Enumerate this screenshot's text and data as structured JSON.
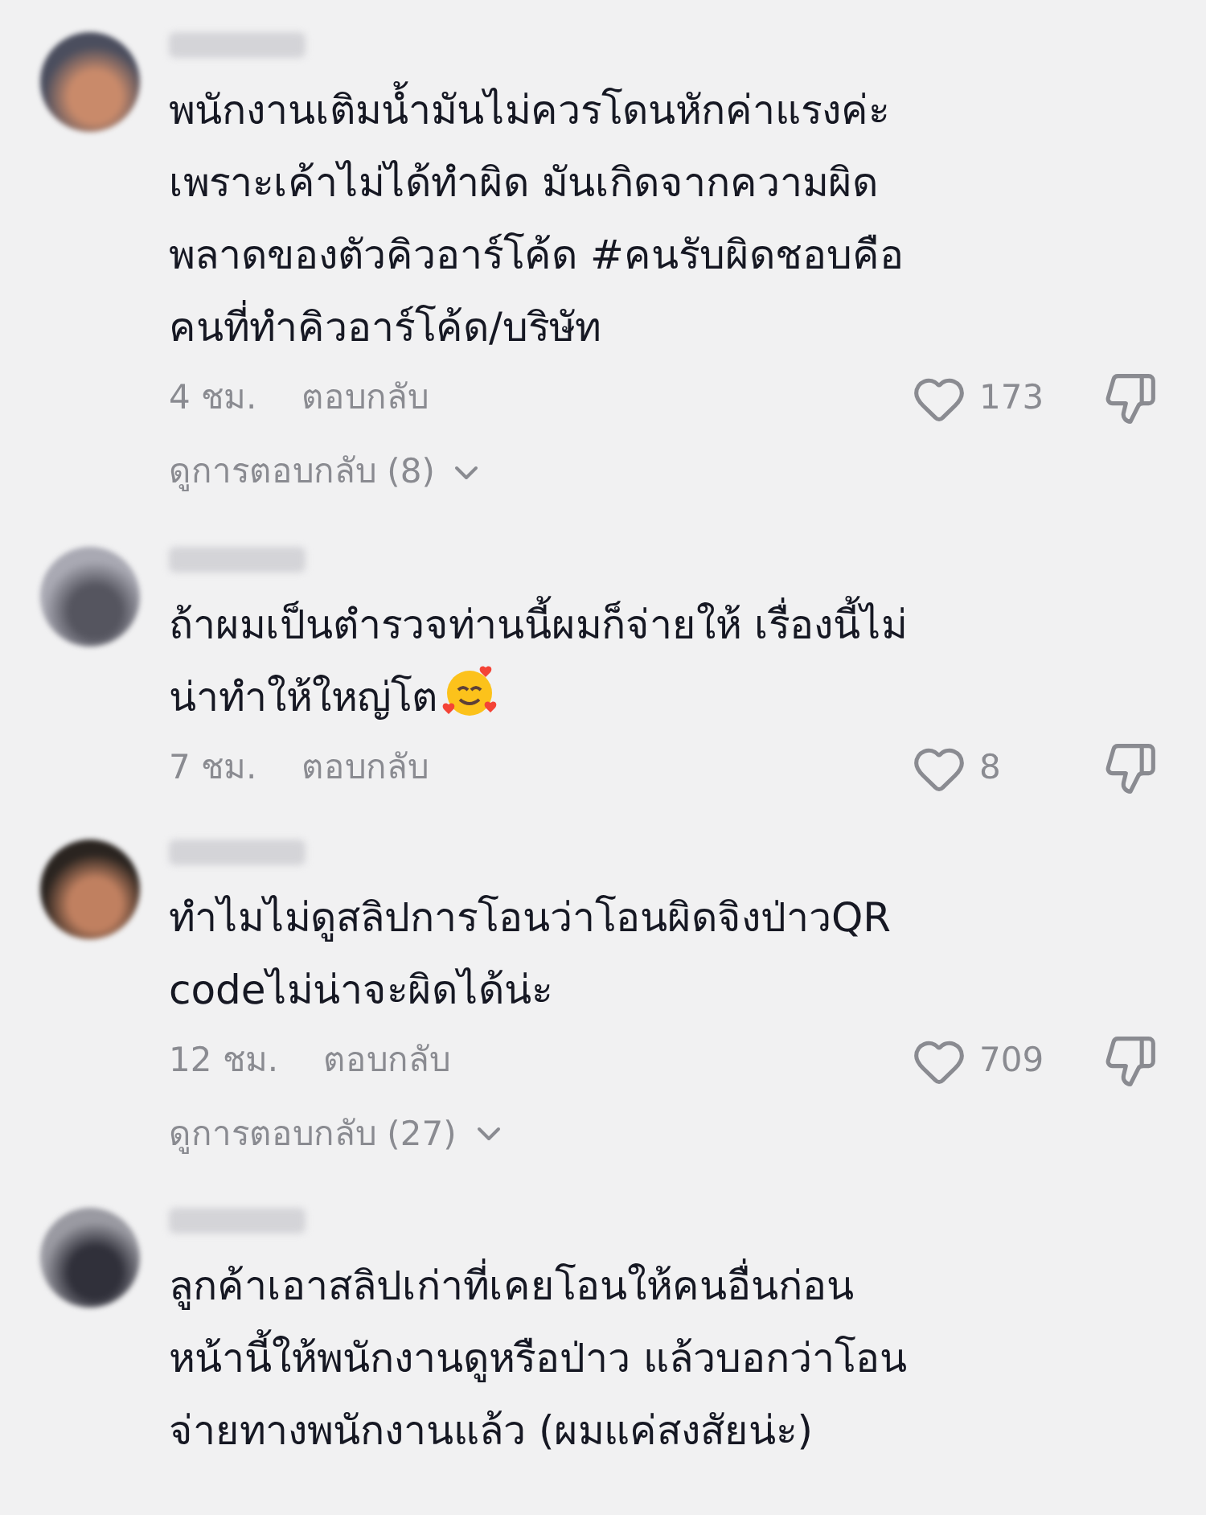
{
  "comments": [
    {
      "lines": [
        "พนักงานเติมน้ำมันไม่ควรโดนหักค่าแรงค่ะ",
        "เพราะเค้าไม่ได้ทำผิด มันเกิดจากความผิด",
        "พลาดของตัวคิวอาร์โค้ด #คนรับผิดชอบคือ",
        "คนที่ทำคิวอาร์โค้ด/บริษัท"
      ],
      "has_emoji": false,
      "time": "4 ชม.",
      "reply": "ตอบกลับ",
      "likes": "173",
      "view_replies": "ดูการตอบกลับ (8)"
    },
    {
      "lines": [
        "ถ้าผมเป็นตำรวจท่านนี้ผมก็จ่ายให้ เรื่องนี้ไม่",
        "น่าทำให้ใหญ่โต"
      ],
      "has_emoji": true,
      "time": "7 ชม.",
      "reply": "ตอบกลับ",
      "likes": "8"
    },
    {
      "lines": [
        "ทำไมไม่ดูสลิปการโอนว่าโอนผิดจิงป่าวQR",
        "codeไม่น่าจะผิดได้น่ะ"
      ],
      "has_emoji": false,
      "time": "12 ชม.",
      "reply": "ตอบกลับ",
      "likes": "709",
      "view_replies": "ดูการตอบกลับ (27)"
    },
    {
      "lines": [
        "ลูกค้าเอาสลิปเก่าที่เคยโอนให้คนอื่นก่อน",
        "หน้านี้ให้พนักงานดูหรือป่าว แล้วบอกว่าโอน",
        "จ่ายทางพนักงานแล้ว (ผมแค่สงสัยน่ะ)"
      ],
      "has_emoji": false
    }
  ]
}
